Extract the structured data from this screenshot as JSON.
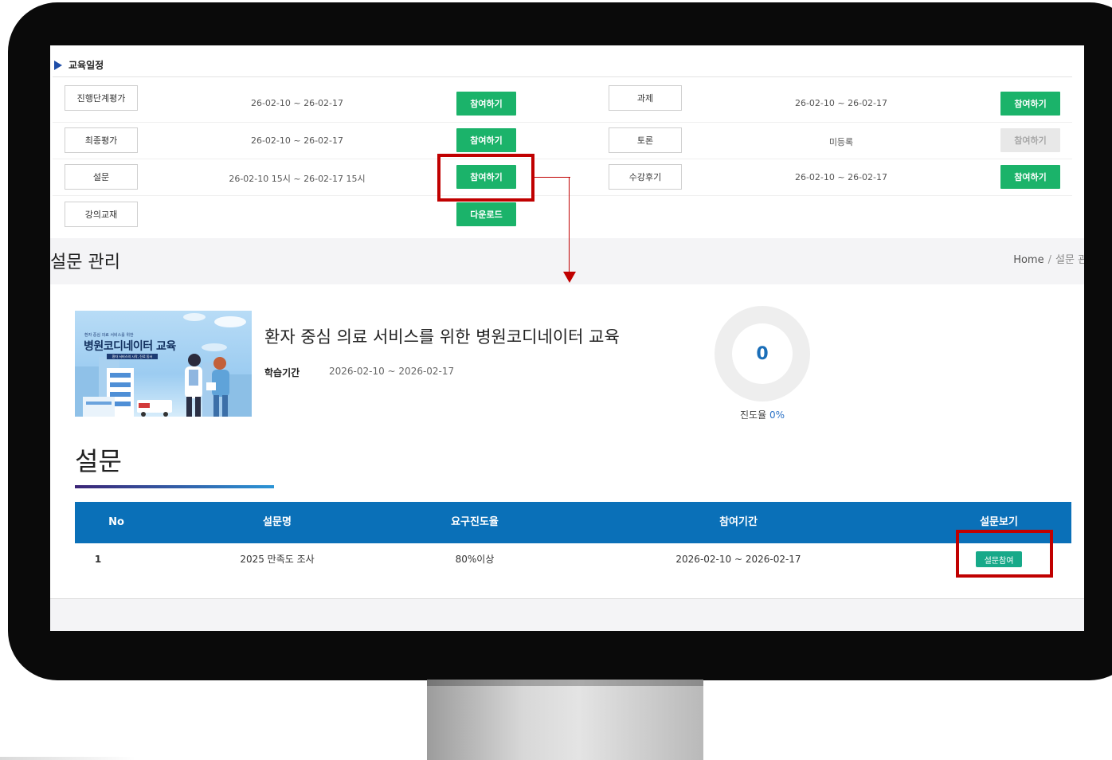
{
  "schedule": {
    "title": "교육일정",
    "rows": [
      {
        "left_label": "진행단계평가",
        "left_date": "26-02-10 ~ 26-02-17",
        "left_btn": "참여하기",
        "right_label": "과제",
        "right_date": "26-02-10 ~ 26-02-17",
        "right_btn": "참여하기"
      },
      {
        "left_label": "최종평가",
        "left_date": "26-02-10 ~ 26-02-17",
        "left_btn": "참여하기",
        "right_label": "토론",
        "right_date": "미등록",
        "right_btn": "참여하기"
      },
      {
        "left_label": "설문",
        "left_date": "26-02-10 15시 ~ 26-02-17 15시",
        "left_btn": "참여하기",
        "right_label": "수강후기",
        "right_date": "26-02-10 ~ 26-02-17",
        "right_btn": "참여하기"
      },
      {
        "left_label": "강의교재",
        "left_btn": "다운로드"
      }
    ]
  },
  "header": {
    "title": "설문 관리",
    "breadcrumb": {
      "home": "Home",
      "separator": "/",
      "current": "설문 관"
    }
  },
  "course": {
    "thumbnail": {
      "small": "환자 중심 의료 서비스를 위한",
      "big": "병원코디네이터 교육",
      "band": "환자 서비스의 시작, 진료 동서"
    },
    "title": "환자 중심 의료 서비스를 위한 병원코디네이터 교육",
    "period_label": "학습기간",
    "period_value": "2026-02-10 ~ 2026-02-17",
    "progress_count": "0",
    "progress_label": "진도율",
    "progress_pct": "0%"
  },
  "survey": {
    "section_title": "설문",
    "columns": [
      "No",
      "설문명",
      "요구진도율",
      "참여기간",
      "설문보기"
    ],
    "rows": [
      {
        "no": "1",
        "name": "2025 만족도 조사",
        "required": "80%이상",
        "period": "2026-02-10 ~ 2026-02-17",
        "action": "설문참여"
      }
    ]
  },
  "colors": {
    "green_button": "#1bb36a",
    "table_header": "#0a70b8",
    "survey_button": "#17a989",
    "highlight": "#c00000"
  }
}
